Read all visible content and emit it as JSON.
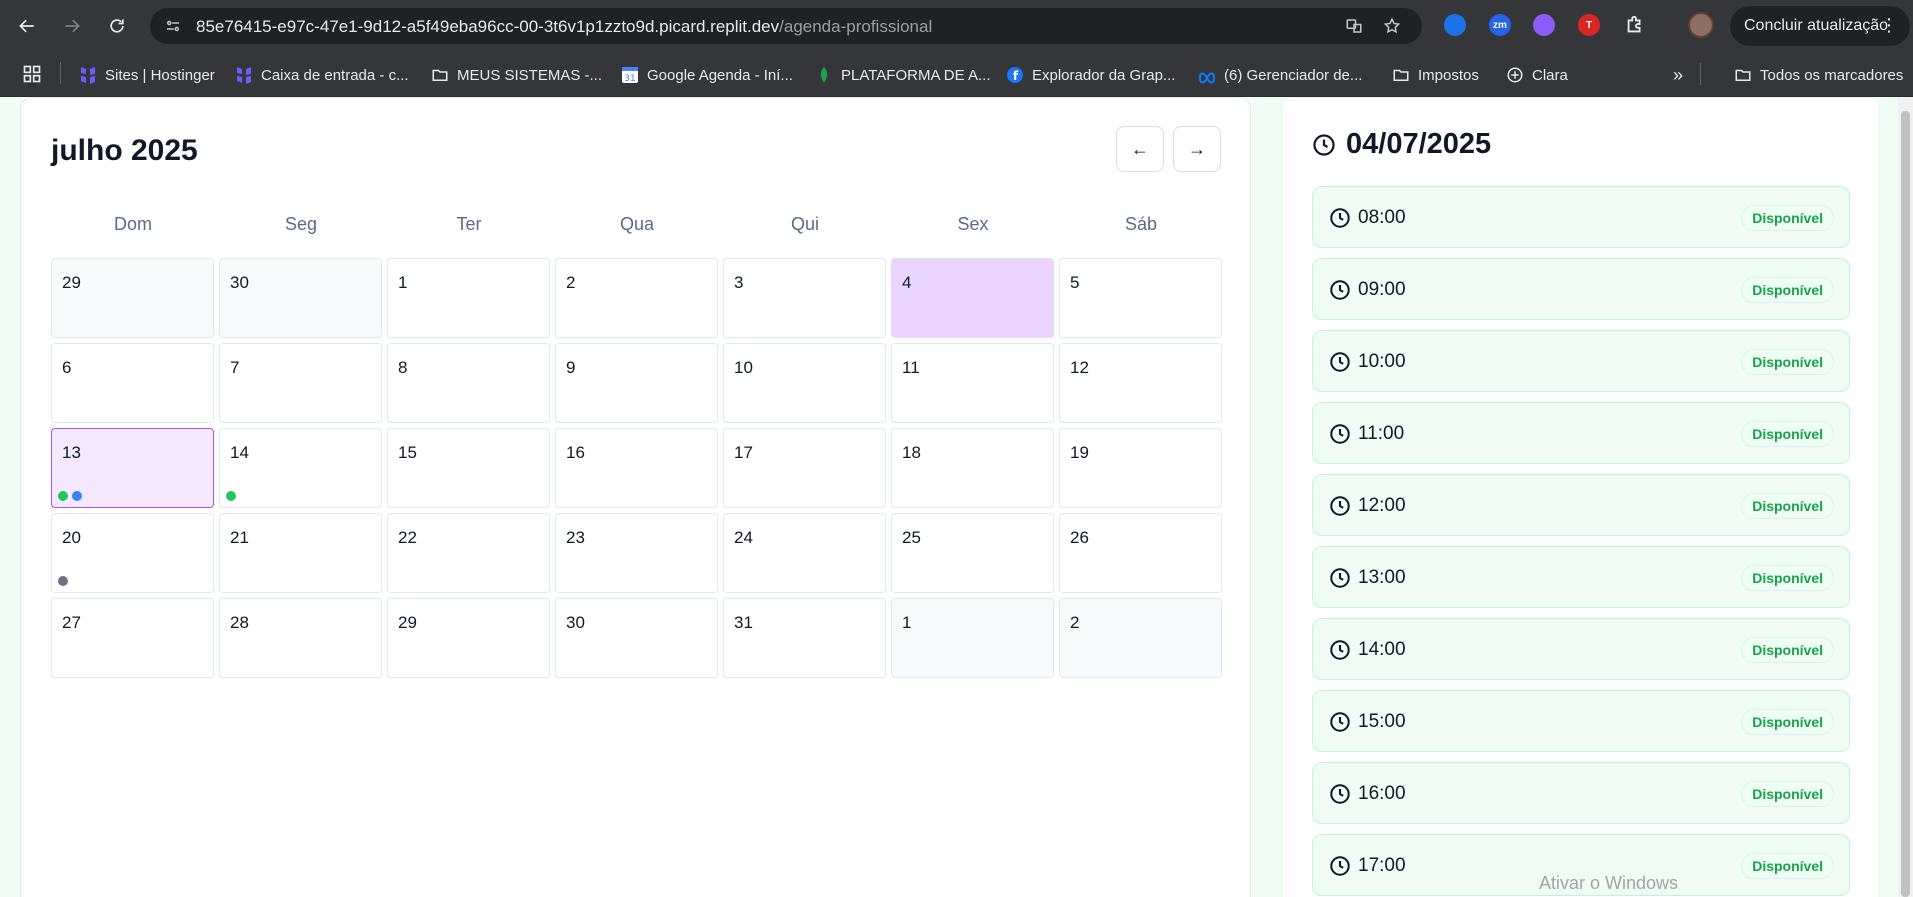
{
  "browser": {
    "url_host": "85e76415-e97c-47e1-9d12-a5f49eba96cc-00-3t6v1p1zzto9d.picard.replit.dev",
    "url_path": "/agenda-profissional",
    "update_button": "Concluir atualização",
    "extensions": [
      {
        "name": "circle-extension-icon",
        "text": "",
        "color": "#1a73e8"
      },
      {
        "name": "zoom-extension-icon",
        "text": "zm",
        "color": "#2563eb"
      },
      {
        "name": "game-extension-icon",
        "text": "",
        "color": "#8b5cf6"
      },
      {
        "name": "t-extension-icon",
        "text": "T",
        "color": "#dc2626"
      }
    ]
  },
  "bookmarks": [
    {
      "label": "Sites | Hostinger",
      "icon": "hostinger-icon"
    },
    {
      "label": "Caixa de entrada - c...",
      "icon": "hostinger-icon"
    },
    {
      "label": "MEUS SISTEMAS -...",
      "icon": "folder-icon"
    },
    {
      "label": "Google Agenda - Iní...",
      "icon": "calendar-icon"
    },
    {
      "label": "PLATAFORMA DE A...",
      "icon": "leaf-icon"
    },
    {
      "label": "Explorador da Grap...",
      "icon": "facebook-icon"
    },
    {
      "label": "(6) Gerenciador de...",
      "icon": "meta-icon"
    },
    {
      "label": "Impostos",
      "icon": "folder-icon"
    },
    {
      "label": "Clara",
      "icon": "plus-circle-icon"
    },
    {
      "label": "Todos os marcadores",
      "icon": "folder-icon"
    }
  ],
  "calendar": {
    "month_title": "julho 2025",
    "prev_label": "←",
    "next_label": "→",
    "weekdays": [
      "Dom",
      "Seg",
      "Ter",
      "Qua",
      "Qui",
      "Sex",
      "Sáb"
    ],
    "days": [
      {
        "n": "29",
        "state": "other",
        "dots": []
      },
      {
        "n": "30",
        "state": "other",
        "dots": []
      },
      {
        "n": "1",
        "state": "",
        "dots": []
      },
      {
        "n": "2",
        "state": "",
        "dots": []
      },
      {
        "n": "3",
        "state": "",
        "dots": []
      },
      {
        "n": "4",
        "state": "today",
        "dots": []
      },
      {
        "n": "5",
        "state": "",
        "dots": []
      },
      {
        "n": "6",
        "state": "",
        "dots": []
      },
      {
        "n": "7",
        "state": "",
        "dots": []
      },
      {
        "n": "8",
        "state": "",
        "dots": []
      },
      {
        "n": "9",
        "state": "",
        "dots": []
      },
      {
        "n": "10",
        "state": "",
        "dots": []
      },
      {
        "n": "11",
        "state": "",
        "dots": []
      },
      {
        "n": "12",
        "state": "",
        "dots": []
      },
      {
        "n": "13",
        "state": "selected",
        "dots": [
          "#22c55e",
          "#3b82f6"
        ]
      },
      {
        "n": "14",
        "state": "",
        "dots": [
          "#22c55e"
        ]
      },
      {
        "n": "15",
        "state": "",
        "dots": []
      },
      {
        "n": "16",
        "state": "",
        "dots": []
      },
      {
        "n": "17",
        "state": "",
        "dots": []
      },
      {
        "n": "18",
        "state": "",
        "dots": []
      },
      {
        "n": "19",
        "state": "",
        "dots": []
      },
      {
        "n": "20",
        "state": "",
        "dots": [
          "#6b7280"
        ]
      },
      {
        "n": "21",
        "state": "",
        "dots": []
      },
      {
        "n": "22",
        "state": "",
        "dots": []
      },
      {
        "n": "23",
        "state": "",
        "dots": []
      },
      {
        "n": "24",
        "state": "",
        "dots": []
      },
      {
        "n": "25",
        "state": "",
        "dots": []
      },
      {
        "n": "26",
        "state": "",
        "dots": []
      },
      {
        "n": "27",
        "state": "",
        "dots": []
      },
      {
        "n": "28",
        "state": "",
        "dots": []
      },
      {
        "n": "29",
        "state": "",
        "dots": []
      },
      {
        "n": "30",
        "state": "",
        "dots": []
      },
      {
        "n": "31",
        "state": "",
        "dots": []
      },
      {
        "n": "1",
        "state": "other",
        "dots": []
      },
      {
        "n": "2",
        "state": "other",
        "dots": []
      }
    ]
  },
  "schedule": {
    "date": "04/07/2025",
    "slots": [
      {
        "time": "08:00",
        "status": "Disponível"
      },
      {
        "time": "09:00",
        "status": "Disponível"
      },
      {
        "time": "10:00",
        "status": "Disponível"
      },
      {
        "time": "11:00",
        "status": "Disponível"
      },
      {
        "time": "12:00",
        "status": "Disponível"
      },
      {
        "time": "13:00",
        "status": "Disponível"
      },
      {
        "time": "14:00",
        "status": "Disponível"
      },
      {
        "time": "15:00",
        "status": "Disponível"
      },
      {
        "time": "16:00",
        "status": "Disponível"
      },
      {
        "time": "17:00",
        "status": "Disponível"
      }
    ]
  },
  "watermark": "Ativar o Windows"
}
